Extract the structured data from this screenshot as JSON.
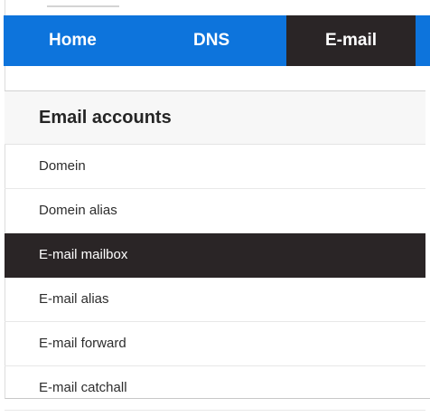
{
  "nav": {
    "items": [
      {
        "label": "Home"
      },
      {
        "label": "DNS"
      },
      {
        "label": "E-mail"
      }
    ],
    "active": "E-mail"
  },
  "sidebar": {
    "heading": "Email accounts",
    "items": [
      {
        "label": "Domein"
      },
      {
        "label": "Domein alias"
      },
      {
        "label": "E-mail mailbox"
      },
      {
        "label": "E-mail alias"
      },
      {
        "label": "E-mail forward"
      },
      {
        "label": "E-mail catchall"
      }
    ],
    "active": "E-mail mailbox"
  },
  "colors": {
    "nav_background": "#0d74dc",
    "active_background": "#2a2526",
    "heading_background": "#f7f7f7"
  }
}
